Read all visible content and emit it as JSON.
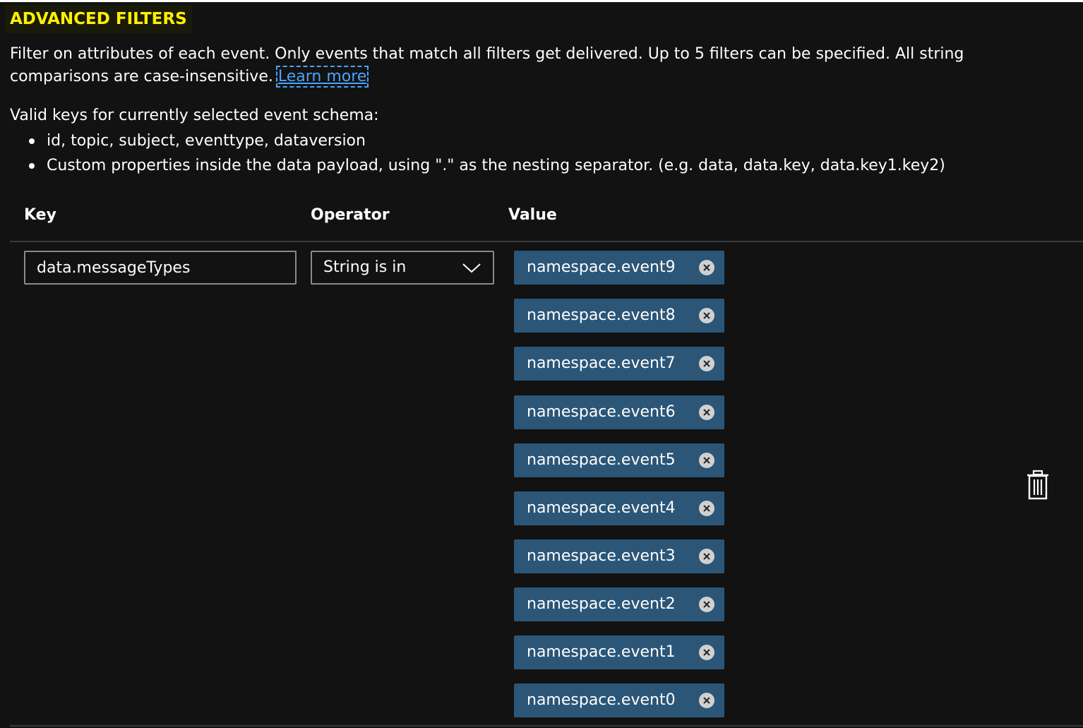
{
  "section": {
    "title": "ADVANCED FILTERS",
    "description": "Filter on attributes of each event. Only events that match all filters get delivered. Up to 5 filters can be specified. All string comparisons are case-insensitive.",
    "learn_more": "Learn more"
  },
  "keys_info": {
    "intro": "Valid keys for currently selected event schema:",
    "items": [
      "id, topic, subject, eventtype, dataversion",
      "Custom properties inside the data payload, using \".\" as the nesting separator. (e.g. data, data.key, data.key1.key2)"
    ]
  },
  "table": {
    "headers": {
      "key": "Key",
      "operator": "Operator",
      "value": "Value"
    },
    "row": {
      "key_value": "data.messageTypes",
      "operator": "String is in",
      "values": [
        "namespace.event9",
        "namespace.event8",
        "namespace.event7",
        "namespace.event6",
        "namespace.event5",
        "namespace.event4",
        "namespace.event3",
        "namespace.event2",
        "namespace.event1",
        "namespace.event0"
      ]
    }
  },
  "icons": {
    "operator_dropdown": "chevron-down-icon",
    "tag_remove": "close-circle-icon",
    "delete_row": "trash-icon"
  },
  "colors": {
    "title": "#fff000",
    "link": "#4aa3ff",
    "tag_background": "#2b5677",
    "background": "#121212"
  }
}
